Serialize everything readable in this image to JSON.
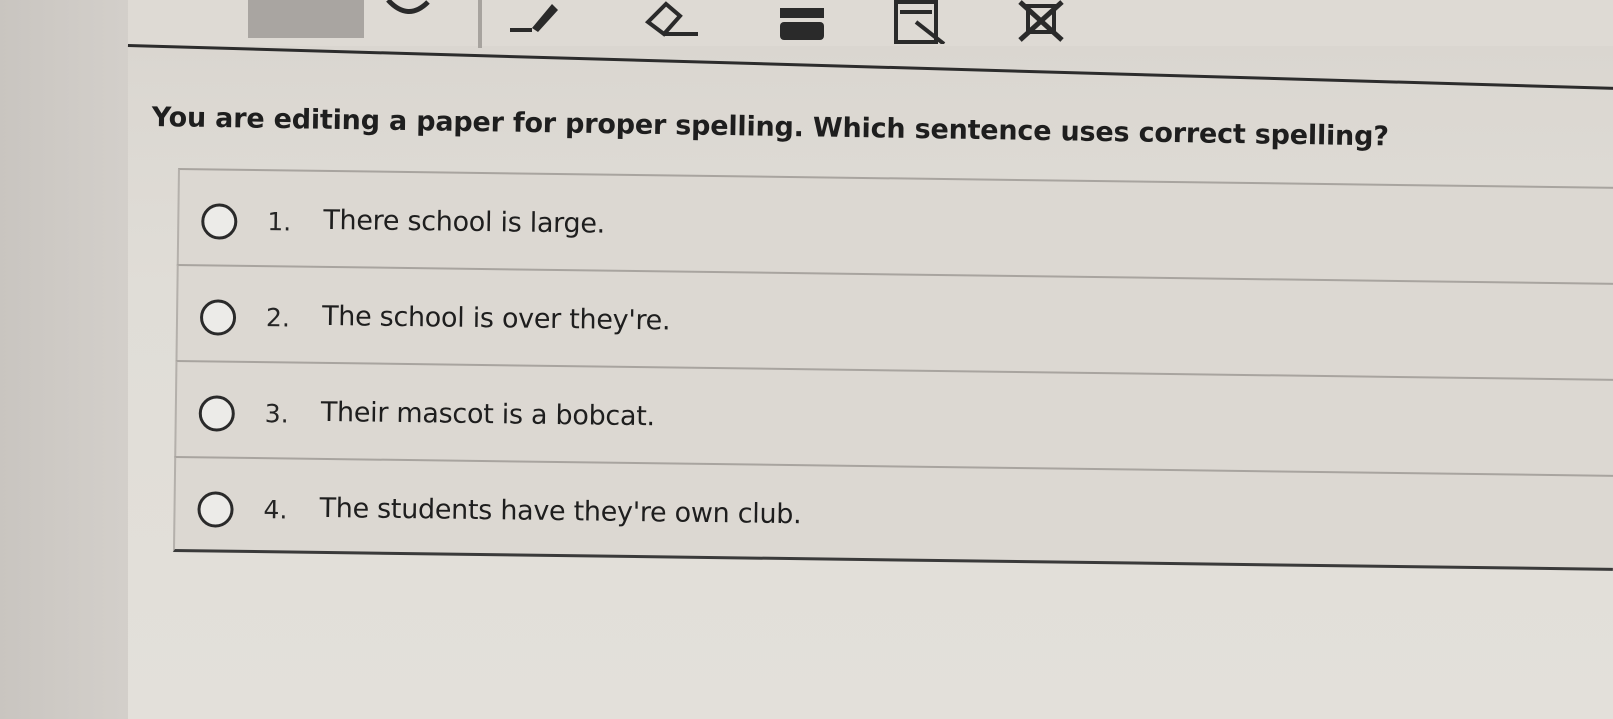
{
  "toolbar": {
    "icons": [
      "magnifier-icon",
      "pen-icon",
      "eraser-icon",
      "print-icon",
      "notepad-icon",
      "close-x-icon"
    ]
  },
  "question": {
    "text": "You are editing a paper for proper spelling. Which sentence uses correct spelling?"
  },
  "options": [
    {
      "number": "1.",
      "text": "There school is large."
    },
    {
      "number": "2.",
      "text": "The school is over they're."
    },
    {
      "number": "3.",
      "text": "Their mascot is a bobcat."
    },
    {
      "number": "4.",
      "text": "The students have they're own club."
    }
  ]
}
